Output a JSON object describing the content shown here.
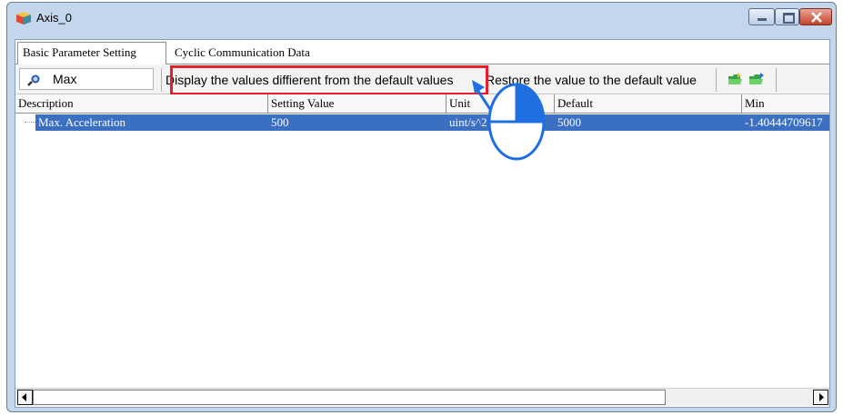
{
  "window": {
    "title": "Axis_0"
  },
  "tabs": [
    {
      "label": "Basic Parameter Setting"
    },
    {
      "label": "Cyclic Communication Data"
    }
  ],
  "toolbar": {
    "search_value": "Max",
    "diff_label": "Display the values diffierent from the default values",
    "restore_label": "Restore the value to the default value"
  },
  "grid": {
    "columns": [
      "Description",
      "Setting Value",
      "Unit",
      "Default",
      "Min"
    ],
    "rows": [
      {
        "description": "Max. Acceleration",
        "setting_value": "500",
        "unit": "uint/s^2",
        "default": "5000",
        "min": "-1.40444709617"
      }
    ]
  },
  "colors": {
    "highlight": "#e6202a",
    "selection": "#3b6fc2",
    "pointer": "#1f6fe0"
  }
}
